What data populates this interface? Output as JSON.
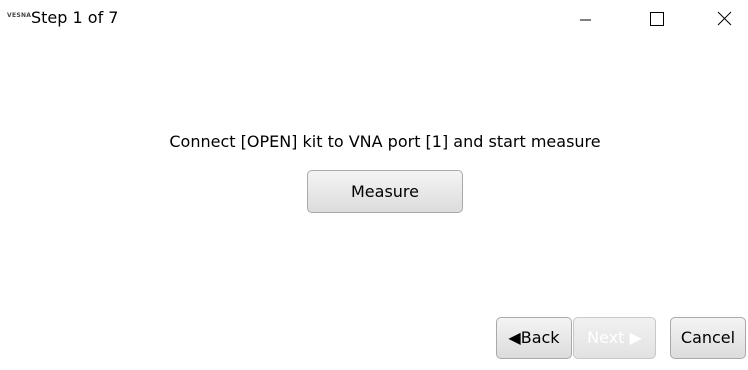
{
  "window": {
    "logo_text": "VESNA",
    "title": "Step 1 of 7",
    "controls": {
      "minimize_icon": "minimize-icon",
      "maximize_icon": "maximize-icon",
      "close_icon": "close-icon"
    }
  },
  "main": {
    "instruction": "Connect [OPEN] kit to VNA port [1] and start measure",
    "measure_label": "Measure"
  },
  "footer": {
    "back_label": "◀Back",
    "next_label": "Next ▶",
    "next_enabled": false,
    "cancel_label": "Cancel"
  }
}
